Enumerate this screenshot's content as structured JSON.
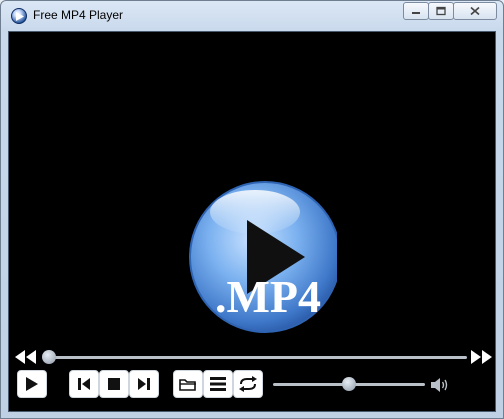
{
  "window": {
    "title": "Free MP4 Player",
    "buttons": {
      "minimize_icon": "minimize-icon",
      "maximize_icon": "maximize-icon",
      "close_icon": "close-icon"
    }
  },
  "video": {
    "logo_text": ".MP4"
  },
  "seek": {
    "progress": 0.0
  },
  "controls": {
    "play_icon": "play-icon",
    "previous_icon": "skip-previous-icon",
    "stop_icon": "stop-icon",
    "next_icon": "skip-next-icon",
    "open_icon": "folder-icon",
    "playlist_icon": "list-icon",
    "repeat_icon": "repeat-icon"
  },
  "volume": {
    "level": 0.5
  },
  "colors": {
    "video_background": "#000000",
    "logo_blue": "#4a86d6",
    "title_text": "#000000"
  }
}
